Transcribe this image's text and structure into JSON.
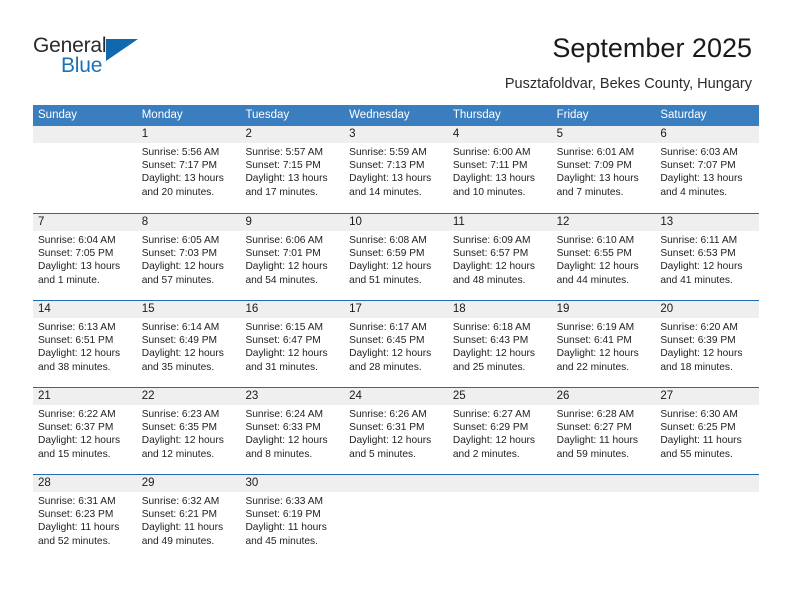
{
  "brand": {
    "name_part1": "General",
    "name_part2": "Blue",
    "flag_icon": "triangle-flag-icon"
  },
  "header": {
    "title": "September 2025",
    "subtitle": "Pusztafoldvar, Bekes County, Hungary"
  },
  "calendar": {
    "weekdays": [
      "Sunday",
      "Monday",
      "Tuesday",
      "Wednesday",
      "Thursday",
      "Friday",
      "Saturday"
    ],
    "colors": {
      "header_blue": "#3a7ebf",
      "row_divider_blue": "#1f6cb0",
      "daynum_band": "#efefef",
      "brand_blue": "#1268ad"
    },
    "weeks": [
      {
        "days": [
          {
            "num": "",
            "lines": [
              "",
              "",
              "",
              ""
            ]
          },
          {
            "num": "1",
            "lines": [
              "Sunrise: 5:56 AM",
              "Sunset: 7:17 PM",
              "Daylight: 13 hours",
              "and 20 minutes."
            ]
          },
          {
            "num": "2",
            "lines": [
              "Sunrise: 5:57 AM",
              "Sunset: 7:15 PM",
              "Daylight: 13 hours",
              "and 17 minutes."
            ]
          },
          {
            "num": "3",
            "lines": [
              "Sunrise: 5:59 AM",
              "Sunset: 7:13 PM",
              "Daylight: 13 hours",
              "and 14 minutes."
            ]
          },
          {
            "num": "4",
            "lines": [
              "Sunrise: 6:00 AM",
              "Sunset: 7:11 PM",
              "Daylight: 13 hours",
              "and 10 minutes."
            ]
          },
          {
            "num": "5",
            "lines": [
              "Sunrise: 6:01 AM",
              "Sunset: 7:09 PM",
              "Daylight: 13 hours",
              "and 7 minutes."
            ]
          },
          {
            "num": "6",
            "lines": [
              "Sunrise: 6:03 AM",
              "Sunset: 7:07 PM",
              "Daylight: 13 hours",
              "and 4 minutes."
            ]
          }
        ]
      },
      {
        "days": [
          {
            "num": "7",
            "lines": [
              "Sunrise: 6:04 AM",
              "Sunset: 7:05 PM",
              "Daylight: 13 hours",
              "and 1 minute."
            ]
          },
          {
            "num": "8",
            "lines": [
              "Sunrise: 6:05 AM",
              "Sunset: 7:03 PM",
              "Daylight: 12 hours",
              "and 57 minutes."
            ]
          },
          {
            "num": "9",
            "lines": [
              "Sunrise: 6:06 AM",
              "Sunset: 7:01 PM",
              "Daylight: 12 hours",
              "and 54 minutes."
            ]
          },
          {
            "num": "10",
            "lines": [
              "Sunrise: 6:08 AM",
              "Sunset: 6:59 PM",
              "Daylight: 12 hours",
              "and 51 minutes."
            ]
          },
          {
            "num": "11",
            "lines": [
              "Sunrise: 6:09 AM",
              "Sunset: 6:57 PM",
              "Daylight: 12 hours",
              "and 48 minutes."
            ]
          },
          {
            "num": "12",
            "lines": [
              "Sunrise: 6:10 AM",
              "Sunset: 6:55 PM",
              "Daylight: 12 hours",
              "and 44 minutes."
            ]
          },
          {
            "num": "13",
            "lines": [
              "Sunrise: 6:11 AM",
              "Sunset: 6:53 PM",
              "Daylight: 12 hours",
              "and 41 minutes."
            ]
          }
        ]
      },
      {
        "days": [
          {
            "num": "14",
            "lines": [
              "Sunrise: 6:13 AM",
              "Sunset: 6:51 PM",
              "Daylight: 12 hours",
              "and 38 minutes."
            ]
          },
          {
            "num": "15",
            "lines": [
              "Sunrise: 6:14 AM",
              "Sunset: 6:49 PM",
              "Daylight: 12 hours",
              "and 35 minutes."
            ]
          },
          {
            "num": "16",
            "lines": [
              "Sunrise: 6:15 AM",
              "Sunset: 6:47 PM",
              "Daylight: 12 hours",
              "and 31 minutes."
            ]
          },
          {
            "num": "17",
            "lines": [
              "Sunrise: 6:17 AM",
              "Sunset: 6:45 PM",
              "Daylight: 12 hours",
              "and 28 minutes."
            ]
          },
          {
            "num": "18",
            "lines": [
              "Sunrise: 6:18 AM",
              "Sunset: 6:43 PM",
              "Daylight: 12 hours",
              "and 25 minutes."
            ]
          },
          {
            "num": "19",
            "lines": [
              "Sunrise: 6:19 AM",
              "Sunset: 6:41 PM",
              "Daylight: 12 hours",
              "and 22 minutes."
            ]
          },
          {
            "num": "20",
            "lines": [
              "Sunrise: 6:20 AM",
              "Sunset: 6:39 PM",
              "Daylight: 12 hours",
              "and 18 minutes."
            ]
          }
        ]
      },
      {
        "days": [
          {
            "num": "21",
            "lines": [
              "Sunrise: 6:22 AM",
              "Sunset: 6:37 PM",
              "Daylight: 12 hours",
              "and 15 minutes."
            ]
          },
          {
            "num": "22",
            "lines": [
              "Sunrise: 6:23 AM",
              "Sunset: 6:35 PM",
              "Daylight: 12 hours",
              "and 12 minutes."
            ]
          },
          {
            "num": "23",
            "lines": [
              "Sunrise: 6:24 AM",
              "Sunset: 6:33 PM",
              "Daylight: 12 hours",
              "and 8 minutes."
            ]
          },
          {
            "num": "24",
            "lines": [
              "Sunrise: 6:26 AM",
              "Sunset: 6:31 PM",
              "Daylight: 12 hours",
              "and 5 minutes."
            ]
          },
          {
            "num": "25",
            "lines": [
              "Sunrise: 6:27 AM",
              "Sunset: 6:29 PM",
              "Daylight: 12 hours",
              "and 2 minutes."
            ]
          },
          {
            "num": "26",
            "lines": [
              "Sunrise: 6:28 AM",
              "Sunset: 6:27 PM",
              "Daylight: 11 hours",
              "and 59 minutes."
            ]
          },
          {
            "num": "27",
            "lines": [
              "Sunrise: 6:30 AM",
              "Sunset: 6:25 PM",
              "Daylight: 11 hours",
              "and 55 minutes."
            ]
          }
        ]
      },
      {
        "days": [
          {
            "num": "28",
            "lines": [
              "Sunrise: 6:31 AM",
              "Sunset: 6:23 PM",
              "Daylight: 11 hours",
              "and 52 minutes."
            ]
          },
          {
            "num": "29",
            "lines": [
              "Sunrise: 6:32 AM",
              "Sunset: 6:21 PM",
              "Daylight: 11 hours",
              "and 49 minutes."
            ]
          },
          {
            "num": "30",
            "lines": [
              "Sunrise: 6:33 AM",
              "Sunset: 6:19 PM",
              "Daylight: 11 hours",
              "and 45 minutes."
            ]
          },
          {
            "num": "",
            "lines": [
              "",
              "",
              "",
              ""
            ]
          },
          {
            "num": "",
            "lines": [
              "",
              "",
              "",
              ""
            ]
          },
          {
            "num": "",
            "lines": [
              "",
              "",
              "",
              ""
            ]
          },
          {
            "num": "",
            "lines": [
              "",
              "",
              "",
              ""
            ]
          }
        ]
      }
    ]
  }
}
